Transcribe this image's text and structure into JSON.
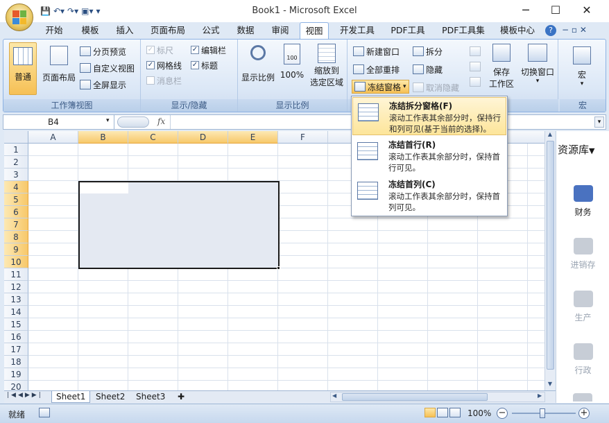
{
  "window": {
    "title": "Book1 - Microsoft Excel",
    "minimize": "─",
    "maximize": "☐",
    "close": "✕"
  },
  "tabs": [
    "开始",
    "模板",
    "插入",
    "页面布局",
    "公式",
    "数据",
    "审阅",
    "视图",
    "开发工具",
    "PDF工具",
    "PDF工具集",
    "模板中心"
  ],
  "active_tab": "视图",
  "ribbon": {
    "workbook_views": {
      "label": "工作簿视图",
      "normal": "普通",
      "page_layout": "页面布局",
      "page_break": "分页预览",
      "custom_views": "自定义视图",
      "full_screen": "全屏显示"
    },
    "show_hide": {
      "label": "显示/隐藏",
      "ruler": "标尺",
      "formula_bar": "编辑栏",
      "gridlines": "网格线",
      "headings": "标题",
      "message_bar": "消息栏"
    },
    "zoom": {
      "label": "显示比例",
      "zoom": "显示比例",
      "zoom100": "100%",
      "zoom_selection_1": "缩放到",
      "zoom_selection_2": "选定区域"
    },
    "window": {
      "new_window": "新建窗口",
      "arrange_all": "全部重排",
      "freeze_panes": "冻结窗格",
      "split": "拆分",
      "hide": "隐藏",
      "unhide": "取消隐藏",
      "save_workspace_1": "保存",
      "save_workspace_2": "工作区",
      "switch_windows": "切换窗口"
    },
    "macros": {
      "label": "宏",
      "macros": "宏"
    }
  },
  "formula_bar": {
    "name_box": "B4",
    "fx": "fx",
    "value": ""
  },
  "grid": {
    "columns": [
      "A",
      "B",
      "C",
      "D",
      "E",
      "F"
    ],
    "selected_columns": [
      "B",
      "C",
      "D",
      "E"
    ],
    "rows": [
      "1",
      "2",
      "3",
      "4",
      "5",
      "6",
      "7",
      "8",
      "9",
      "10",
      "11",
      "12",
      "13",
      "14",
      "15",
      "16",
      "17",
      "18",
      "19",
      "20"
    ],
    "selected_rows": [
      "4",
      "5",
      "6",
      "7",
      "8",
      "9",
      "10"
    ],
    "active_cell": "B4",
    "selection": "B4:E10"
  },
  "sheets": [
    "Sheet1",
    "Sheet2",
    "Sheet3"
  ],
  "active_sheet": "Sheet1",
  "status": {
    "ready": "就绪",
    "zoom": "100%"
  },
  "side_panel": {
    "title": "资源库",
    "items": [
      "财务",
      "进销存",
      "生产",
      "行政"
    ]
  },
  "dropdown": {
    "items": [
      {
        "title": "冻结拆分窗格(F)",
        "desc": "滚动工作表其余部分时，保持行和列可见(基于当前的选择)。"
      },
      {
        "title": "冻结首行(R)",
        "desc": "滚动工作表其余部分时，保持首行可见。"
      },
      {
        "title": "冻结首列(C)",
        "desc": "滚动工作表其余部分时，保持首列可见。"
      }
    ]
  },
  "colors": {
    "ribbon_bg": "#dbe7f6",
    "selection_header": "#f7c86a",
    "selection_fill": "#e4e9f2",
    "accent": "#4a72c0"
  }
}
